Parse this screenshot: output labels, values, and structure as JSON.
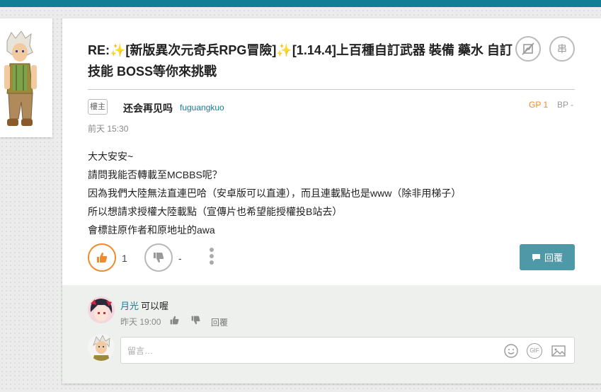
{
  "post": {
    "title": "RE:✨[新版異次元奇兵RPG冒險]✨[1.14.4]上百種自訂武器 裝備 藥水 自訂技能 BOSS等你來挑戰",
    "badge": "樓主",
    "author_name": "还会再见吗",
    "author_account": "fuguangkuo",
    "timestamp": "前天 15:30",
    "gp_label": "GP 1",
    "bp_label": "BP -",
    "content_lines": [
      "大大安安~",
      "請問我能否轉載至MCBBS呢？",
      "因為我們大陸無法直連巴哈（安卓版可以直連），而且連載點也是www（除非用梯子）",
      "所以想請求授權大陸載點（宣傳片也希望能授權投B站去）",
      "會標註原作者和原地址的awa"
    ],
    "like_count": "1",
    "dislike_count": "-",
    "reply_label": "回覆",
    "icon_buttons": {
      "no_image_icon": "no-image-icon",
      "serial_label": "串"
    }
  },
  "comment": {
    "name": "月光",
    "text": "可以喔",
    "time": "昨天 19:00",
    "reply_label": "回覆"
  },
  "composer": {
    "placeholder": "留言…",
    "gif_label": "GIF"
  },
  "colors": {
    "accent": "#117e96",
    "like_orange": "#f08a2a",
    "reply_button": "#4f98a7"
  }
}
